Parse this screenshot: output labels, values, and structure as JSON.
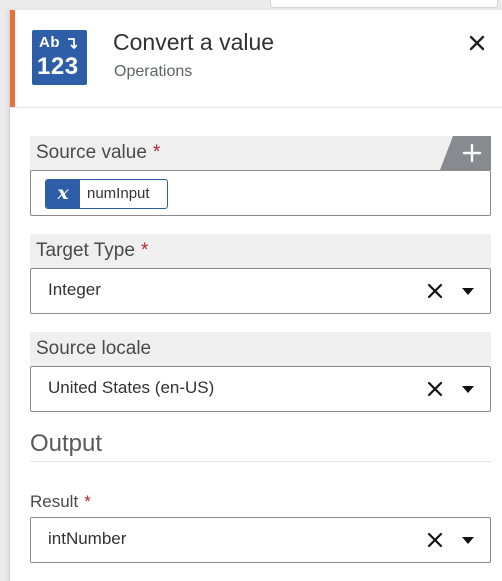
{
  "header": {
    "icon": {
      "name": "convert-value-icon",
      "top_text": "Ab",
      "bottom_text": "123"
    },
    "title": "Convert a value",
    "subtitle": "Operations"
  },
  "fields": {
    "source_value": {
      "label": "Source value",
      "required_mark": "*",
      "variable": {
        "icon": "variable-x-icon",
        "glyph": "x",
        "name": "numInput"
      }
    },
    "target_type": {
      "label": "Target Type",
      "required_mark": "*",
      "value": "Integer"
    },
    "source_locale": {
      "label": "Source locale",
      "value": "United States (en-US)"
    }
  },
  "output": {
    "section_title": "Output",
    "result": {
      "label": "Result",
      "required_mark": "*",
      "value": "intNumber"
    }
  },
  "colors": {
    "accent": "#e8703a",
    "brand_blue": "#2f5ea8",
    "required": "#b3262e",
    "label_bar": "#efefef"
  }
}
